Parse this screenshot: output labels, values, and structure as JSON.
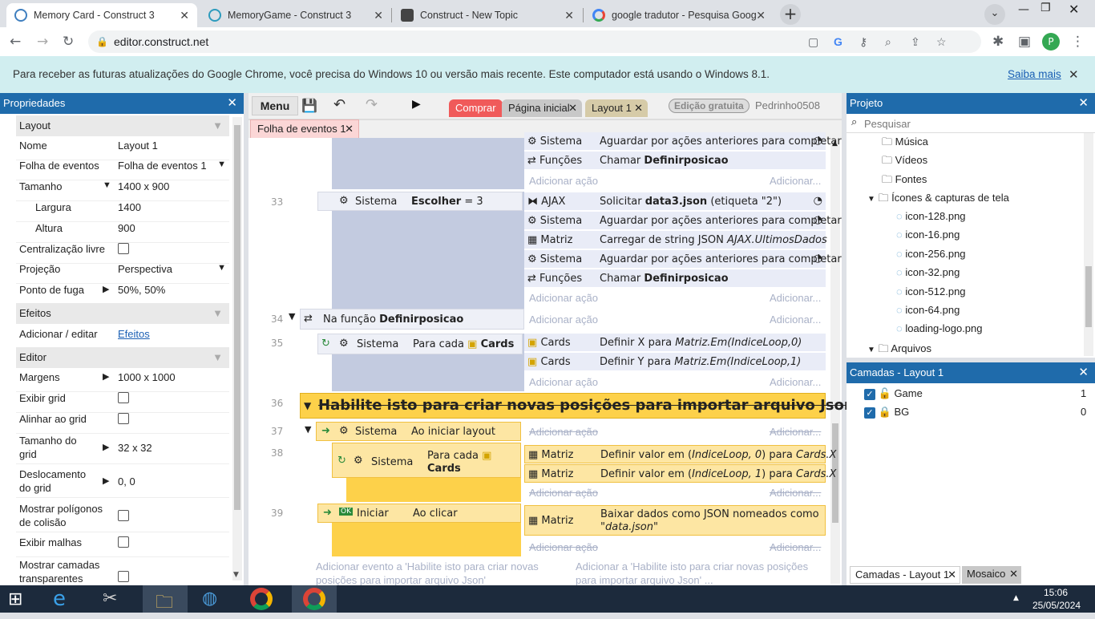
{
  "browser": {
    "tabs": [
      {
        "title": "Memory Card - Construct 3",
        "color": "#3f7fbf"
      },
      {
        "title": "MemoryGame - Construct 3",
        "color": "#2d9bbd"
      },
      {
        "title": "Construct - New Topic",
        "color": "#444444"
      },
      {
        "title": "google tradutor - Pesquisa Goog",
        "color": "#4285f4"
      }
    ],
    "url": "editor.construct.net",
    "profile_initial": "P"
  },
  "infobar": {
    "message": "Para receber as futuras atualizações do Google Chrome, você precisa do Windows 10 ou versão mais recente. Este computador está usando o Windows 8.1.",
    "link": "Saiba mais"
  },
  "properties": {
    "title": "Propriedades",
    "sections": {
      "layout": "Layout",
      "effects": "Efeitos",
      "editor": "Editor"
    },
    "rows": {
      "nome": {
        "k": "Nome",
        "v": "Layout 1"
      },
      "folha": {
        "k": "Folha de eventos",
        "v": "Folha de eventos 1"
      },
      "tamanho": {
        "k": "Tamanho",
        "v": "1400 x 900"
      },
      "largura": {
        "k": "Largura",
        "v": "1400"
      },
      "altura": {
        "k": "Altura",
        "v": "900"
      },
      "central": {
        "k": "Centralização livre"
      },
      "projecao": {
        "k": "Projeção",
        "v": "Perspectiva"
      },
      "fuga": {
        "k": "Ponto de fuga",
        "v": "50%, 50%"
      },
      "efeitos": {
        "k": "Adicionar / editar",
        "v": "Efeitos"
      },
      "margens": {
        "k": "Margens",
        "v": "1000 x 1000"
      },
      "grid": {
        "k": "Exibir grid"
      },
      "alinhar": {
        "k": "Alinhar ao grid"
      },
      "tamgrid": {
        "k1": "Tamanho do",
        "k2": "grid",
        "v": "32 x 32"
      },
      "desloc": {
        "k1": "Deslocamento",
        "k2": "do grid",
        "v": "0, 0"
      },
      "poligonos": {
        "k1": "Mostrar polígonos",
        "k2": "de colisão"
      },
      "malhas": {
        "k": "Exibir malhas"
      },
      "camadas": {
        "k1": "Mostrar camadas",
        "k2": "transparentes"
      }
    }
  },
  "editor_bar": {
    "menu": "Menu",
    "buy": "Comprar",
    "tab_home": "Página inicial",
    "tab_layout": "Layout 1",
    "free": "Edição gratuita",
    "user": "Pedrinho0508",
    "sheet_tab": "Folha de eventos 1"
  },
  "events": {
    "add_action": "Adicionar ação",
    "add_dots": "Adicionar...",
    "sistema": "Sistema",
    "funcoes": "Funções",
    "ajax": "AJAX",
    "matriz": "Matriz",
    "cards": "Cards",
    "aguardar": "Aguardar por ações anteriores para completar",
    "chamar": "Chamar",
    "definirposicao": "Definirposicao",
    "e33_num": "33",
    "e33_cond_a": "Escolher",
    "e33_cond_b": "= 3",
    "solicitar": "Solicitar",
    "data3": "data3.json",
    "etiqueta": "(etiqueta \"2\")",
    "carregar": "Carregar de string JSON",
    "ultimos": "AJAX.UltimosDados",
    "e34_num": "34",
    "na_funcao": "Na função",
    "e35_num": "35",
    "para_cada": "Para cada",
    "defx": "Definir X para",
    "defx_expr": "Matriz.Em(IndiceLoop,0)",
    "defy": "Definir Y para",
    "defy_expr": "Matriz.Em(IndiceLoop,1)",
    "e36_num": "36",
    "group_title": "Habilite isto para criar novas posições para importar arquivo Json",
    "e37_num": "37",
    "ao_iniciar": "Ao iniciar layout",
    "e38_num": "38",
    "para_cada2": "Para cada",
    "cards2": "Cards",
    "def_valor0a": "Definir valor em (",
    "def_valor0b": "IndiceLoop, 0",
    "def_valor0c": ") para",
    "def_valor1b": "IndiceLoop, 1",
    "cardsx": "Cards.X",
    "e39_num": "39",
    "iniciar": "Iniciar",
    "ok": "OK",
    "ao_clicar": "Ao clicar",
    "baixar": "Baixar dados como JSON nomeados como",
    "datajson": "\"data.json\"",
    "add_event_1": "Adicionar evento a 'Habilite isto para criar novas",
    "add_event_2": "posições para importar arquivo Json'",
    "add_action_1": "Adicionar a 'Habilite isto para criar novas posições",
    "add_action_2": "para importar arquivo Json' ..."
  },
  "project": {
    "title": "Projeto",
    "search_placeholder": "Pesquisar",
    "items": [
      "Música",
      "Vídeos",
      "Fontes",
      "Ícones & capturas de tela",
      "icon-128.png",
      "icon-16.png",
      "icon-256.png",
      "icon-32.png",
      "icon-512.png",
      "icon-64.png",
      "loading-logo.png",
      "Arquivos"
    ]
  },
  "layers": {
    "title": "Camadas - Layout 1",
    "items": [
      {
        "name": "Game",
        "index": "1"
      },
      {
        "name": "BG",
        "index": "0"
      }
    ],
    "tab1": "Camadas - Layout 1",
    "tab2": "Mosaico"
  },
  "taskbar": {
    "time": "15:06",
    "date": "25/05/2024"
  }
}
